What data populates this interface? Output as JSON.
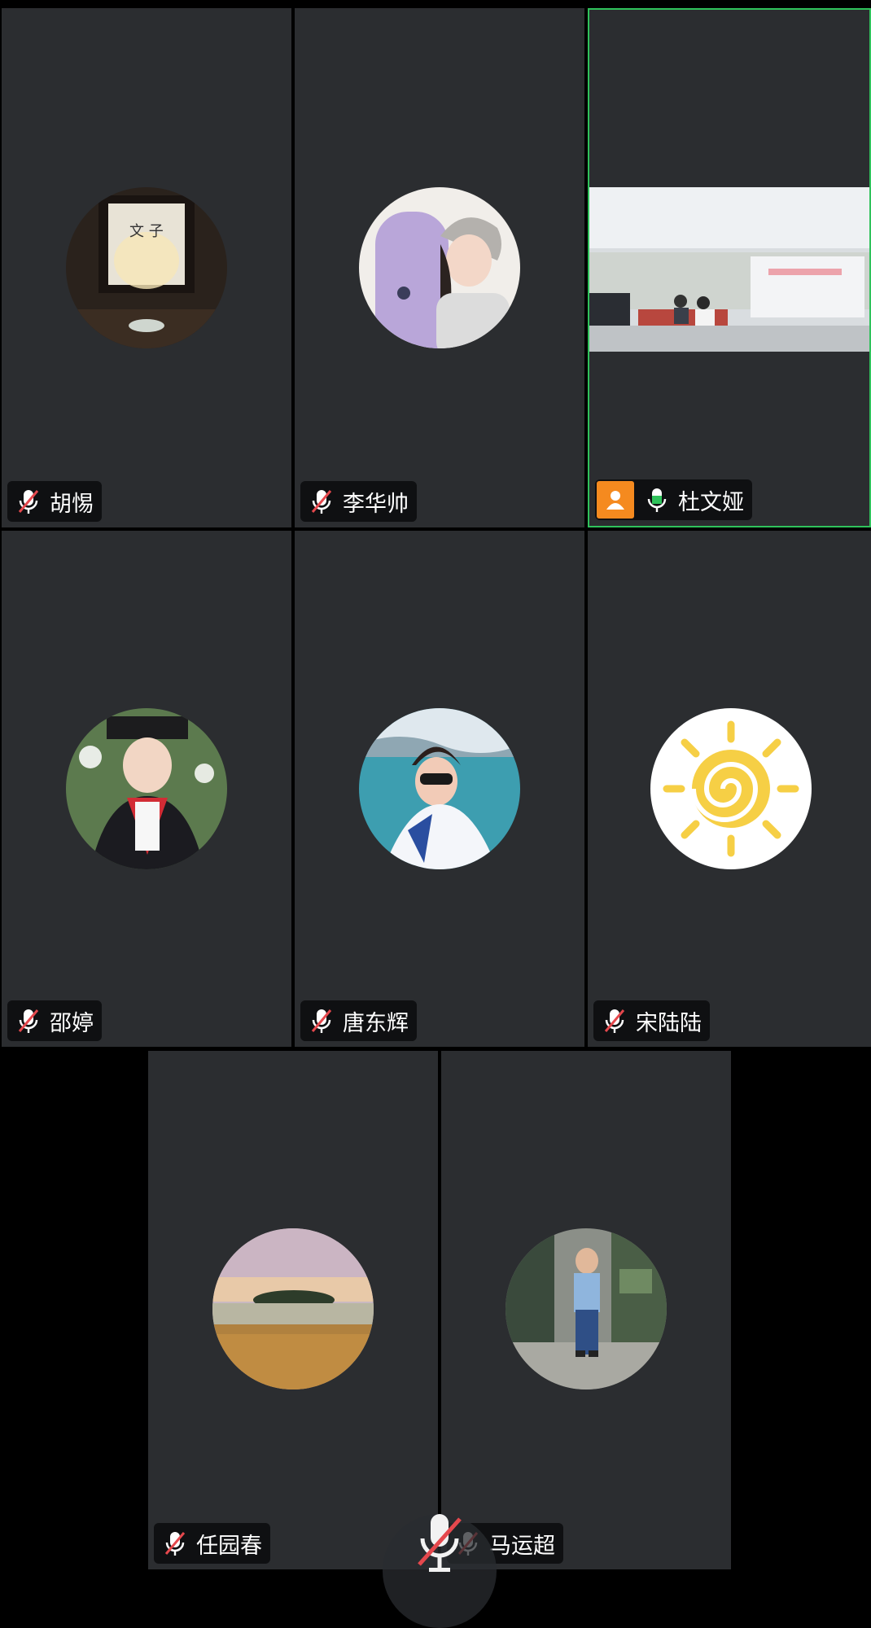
{
  "participants": [
    {
      "name": "胡惕",
      "mic": "muted",
      "avatar": "room-photo"
    },
    {
      "name": "李华帅",
      "mic": "muted",
      "avatar": "woman-skateboard-photo"
    },
    {
      "name": "杜文娅",
      "mic": "on",
      "avatar": "video-feed",
      "host": true
    },
    {
      "name": "邵婷",
      "mic": "muted",
      "avatar": "child-graduation-photo"
    },
    {
      "name": "唐东辉",
      "mic": "muted",
      "avatar": "woman-sea-photo"
    },
    {
      "name": "宋陆陆",
      "mic": "muted",
      "avatar": "sun-drawing"
    },
    {
      "name": "任园春",
      "mic": "muted",
      "avatar": "landscape-photo"
    },
    {
      "name": "马运超",
      "mic": "muted",
      "avatar": "man-street-photo"
    }
  ],
  "colors": {
    "tile_bg": "#2b2d30",
    "active_border": "#2fc25b",
    "host_badge": "#f58a1f",
    "muted_slash": "#e5484d"
  },
  "controls": {
    "self_mic": "muted"
  }
}
